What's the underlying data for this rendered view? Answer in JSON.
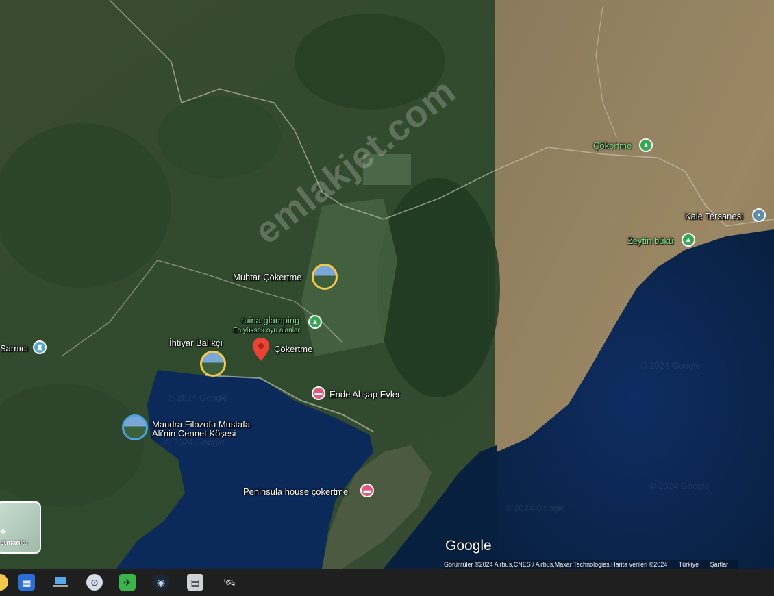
{
  "map": {
    "watermark": "© 2024 Google",
    "site_watermark": "emlakjet.com",
    "labels": {
      "cokertme_village": "Çökertme",
      "kale_tersanesi": "Kale Tersanesi",
      "zeytin_buku": "Zeytin bükü",
      "muhtar": "Muhtar Çökertme",
      "ruina": "ruina glamping",
      "ruina_sub": "En yüksek oyu alanlar",
      "ihtiyar": "İhtiyar Balıkçı",
      "cokertme_pin": "Çökertme",
      "ende": "Ende Ahşap Evler",
      "mandra_line1": "Mandra Filozofu Mustafa",
      "mandra_line2": "Ali'nin Cennet Köşesi",
      "peninsula": "Peninsula house çokertme",
      "sarnici": "Sarnıcı"
    },
    "layers_label": "stmanlar",
    "google_logo": "Google",
    "attribution": {
      "imagery": "Görüntüler ©2024 Airbus,CNES / Airbus,Maxar Technologies,Harita verileri ©2024",
      "country": "Türkiye",
      "terms": "Şartlar"
    },
    "colors": {
      "camp": "#34a853",
      "lodging": "#e3587b",
      "marker": "#ea4335",
      "landmark": "#5f8fa8"
    }
  },
  "taskbar": {
    "icons": [
      "store-icon",
      "laptop-icon",
      "vpn-lock-icon",
      "plane-icon",
      "steam-icon",
      "printer-icon",
      "satellite-icon"
    ]
  }
}
